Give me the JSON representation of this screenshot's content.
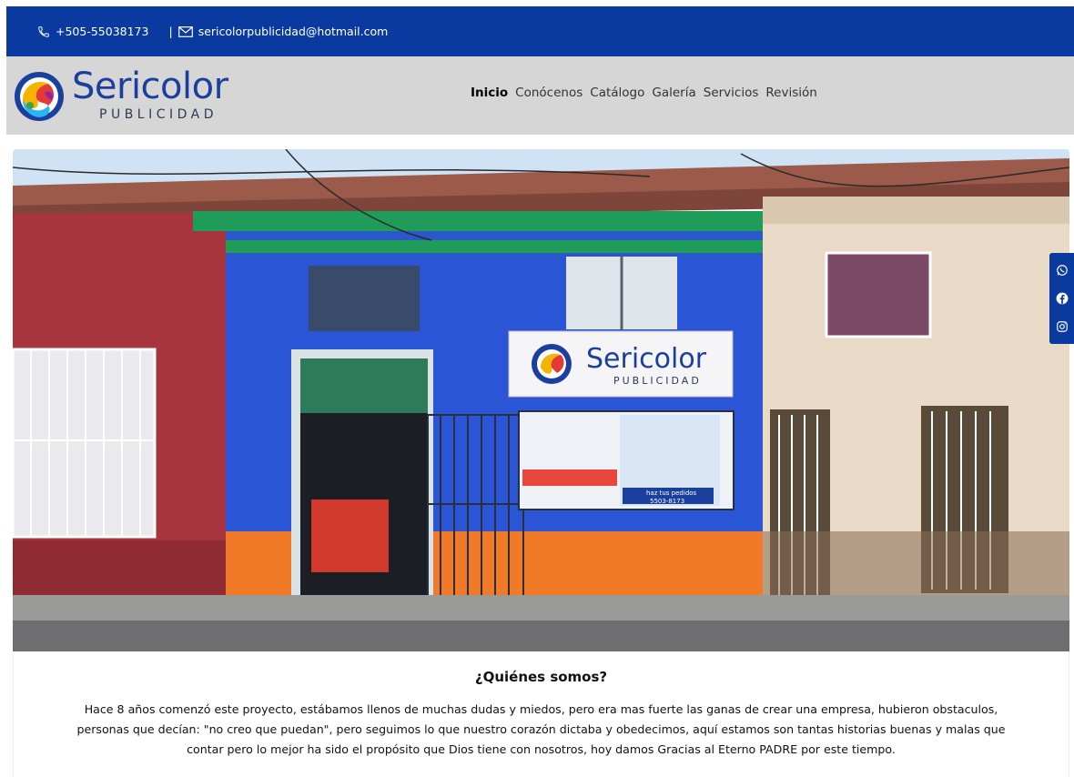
{
  "topbar": {
    "phone": "+505-55038173",
    "separator": "|",
    "email": "sericolorpublicidad@hotmail.com",
    "phone_icon": "phone-icon",
    "email_icon": "envelope-icon"
  },
  "brand": {
    "name": "Sericolor",
    "tagline": "PUBLICIDAD",
    "color": "#1b3f9c"
  },
  "nav": {
    "items": [
      {
        "label": "Inicio",
        "active": true
      },
      {
        "label": "Conócenos",
        "active": false
      },
      {
        "label": "Catálogo",
        "active": false
      },
      {
        "label": "Galería",
        "active": false
      },
      {
        "label": "Servicios",
        "active": false
      },
      {
        "label": "Revisión",
        "active": false
      }
    ]
  },
  "hero": {
    "sign_name": "Sericolor",
    "sign_tagline": "PUBLICIDAD",
    "poster_text": "haz tus pedidos",
    "poster_phone": "5503-8173"
  },
  "social": {
    "icons": [
      "whatsapp-icon",
      "facebook-icon",
      "instagram-icon"
    ]
  },
  "about": {
    "title": "¿Quiénes somos?",
    "line1": "Hace 8 años comenzó este proyecto, estábamos llenos de muchas dudas y miedos, pero era mas fuerte las ganas de crear una empresa, hubieron obstaculos,",
    "line2": "personas que decían: \"no creo que puedan\", pero seguimos lo que nuestro corazón dictaba y obedecimos, aquí estamos son tantas historias buenas y malas que",
    "line3": "contar pero lo mejor ha sido el propósito que Dios tiene con nosotros, hoy damos Gracias al Eterno PADRE por este tiempo."
  },
  "colors": {
    "primary": "#0a3aa0",
    "nav_bg": "#d6d6d6"
  }
}
